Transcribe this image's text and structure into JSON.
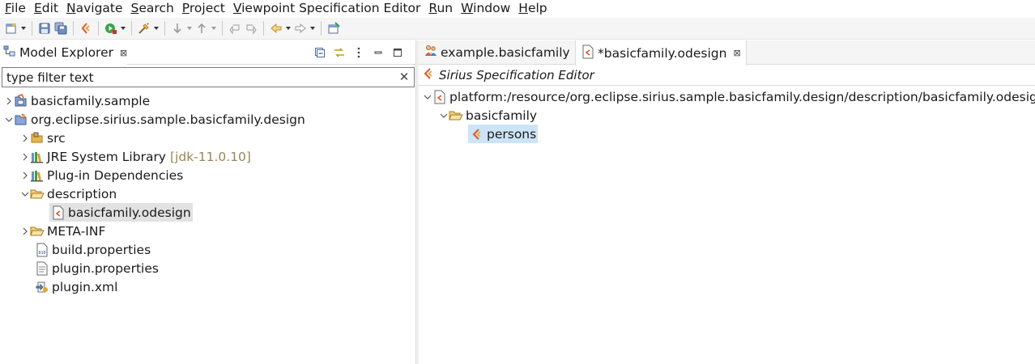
{
  "menu": {
    "items": [
      {
        "mnemonic": "F",
        "rest": "ile"
      },
      {
        "mnemonic": "E",
        "rest": "dit"
      },
      {
        "mnemonic": "N",
        "rest": "avigate"
      },
      {
        "mnemonic": "S",
        "rest": "earch"
      },
      {
        "mnemonic": "P",
        "rest": "roject"
      },
      {
        "mnemonic": "V",
        "rest": "iewpoint Specification Editor"
      },
      {
        "mnemonic": "R",
        "rest": "un"
      },
      {
        "mnemonic": "W",
        "rest": "indow"
      },
      {
        "mnemonic": "H",
        "rest": "elp"
      }
    ]
  },
  "toolbar": {
    "icons": [
      "new-wizard-icon",
      "save-icon",
      "save-all-icon",
      "sirius-refresh-icon",
      "run-icon",
      "debug-icon",
      "skip-breakpoints-icon",
      "next-annotation-icon",
      "previous-annotation-icon",
      "last-edit-icon",
      "back-icon",
      "forward-icon",
      "pin-editor-icon"
    ]
  },
  "model_explorer": {
    "title": "Model Explorer",
    "close_glyph": "⊠",
    "filter_value": "type filter text",
    "clear_glyph": "✕",
    "tree": [
      {
        "label": "basicfamily.sample",
        "extra": ""
      },
      {
        "label": "org.eclipse.sirius.sample.basicfamily.design",
        "extra": ""
      },
      {
        "label": "src",
        "extra": ""
      },
      {
        "label": "JRE System Library",
        "extra": "[jdk-11.0.10]"
      },
      {
        "label": "Plug-in Dependencies",
        "extra": ""
      },
      {
        "label": "description",
        "extra": ""
      },
      {
        "label": "basicfamily.odesign",
        "extra": ""
      },
      {
        "label": "META-INF",
        "extra": ""
      },
      {
        "label": "build.properties",
        "extra": ""
      },
      {
        "label": "plugin.properties",
        "extra": ""
      },
      {
        "label": "plugin.xml",
        "extra": ""
      }
    ]
  },
  "editor": {
    "tabs": [
      {
        "label": "example.basicfamily"
      },
      {
        "label": "*basicfamily.odesign",
        "close_glyph": "⊠"
      }
    ],
    "header_title": "Sirius Specification Editor",
    "tree": [
      {
        "label": "platform:/resource/org.eclipse.sirius.sample.basicfamily.design/description/basicfamily.odesign"
      },
      {
        "label": "basicfamily"
      },
      {
        "label": "persons"
      }
    ]
  },
  "colors": {
    "sirius_accent": "#e0532b",
    "folder": "#e8b54a",
    "selection": "#cce4f7",
    "dim_label": "#9a8757"
  }
}
